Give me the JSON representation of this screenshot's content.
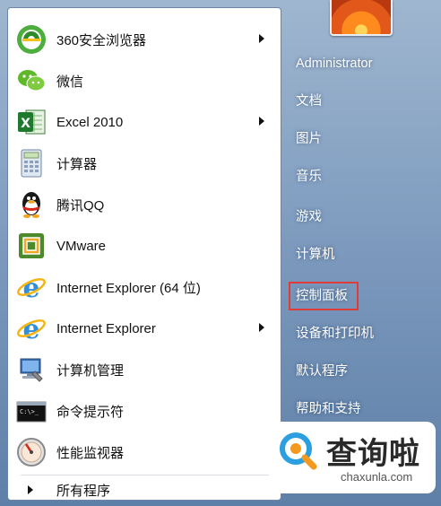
{
  "programs": [
    {
      "label": "360安全浏览器",
      "icon": "360-browser-icon",
      "has_submenu": true
    },
    {
      "label": "微信",
      "icon": "wechat-icon",
      "has_submenu": false
    },
    {
      "label": "Excel 2010",
      "icon": "excel-icon",
      "has_submenu": true
    },
    {
      "label": "计算器",
      "icon": "calculator-icon",
      "has_submenu": false
    },
    {
      "label": "腾讯QQ",
      "icon": "qq-icon",
      "has_submenu": false
    },
    {
      "label": "VMware",
      "icon": "vmware-icon",
      "has_submenu": false
    },
    {
      "label": "Internet Explorer (64 位)",
      "icon": "ie-icon",
      "has_submenu": false
    },
    {
      "label": "Internet Explorer",
      "icon": "ie-icon",
      "has_submenu": true
    },
    {
      "label": "计算机管理",
      "icon": "computer-management-icon",
      "has_submenu": false
    },
    {
      "label": "命令提示符",
      "icon": "command-prompt-icon",
      "has_submenu": false
    },
    {
      "label": "性能监视器",
      "icon": "performance-monitor-icon",
      "has_submenu": false
    }
  ],
  "all_programs": {
    "label": "所有程序"
  },
  "right_panel": {
    "user": "Administrator",
    "items": [
      "文档",
      "图片",
      "音乐",
      "游戏",
      "计算机",
      "控制面板",
      "设备和打印机",
      "默认程序",
      "帮助和支持"
    ],
    "highlighted": "控制面板"
  },
  "watermark": {
    "title": "查询啦",
    "subtitle": "chaxunla.com"
  },
  "colors": {
    "highlight_border": "#e03b3b",
    "panel_blue": "#7f9cbf"
  }
}
